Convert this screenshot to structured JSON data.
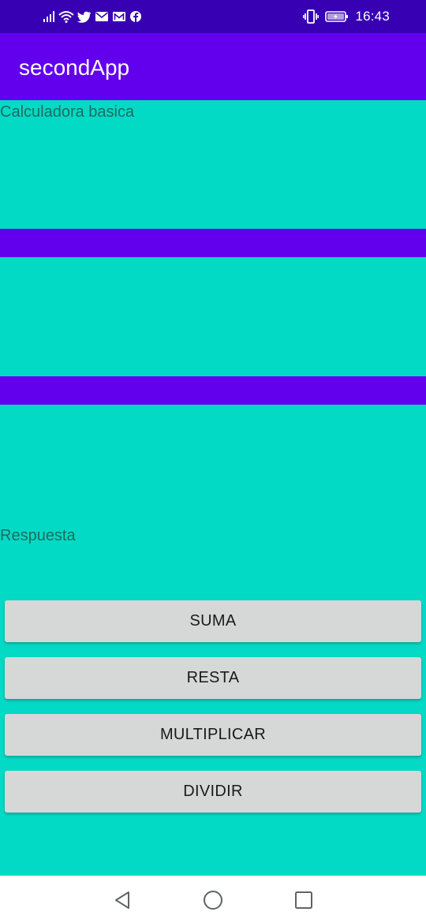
{
  "status_bar": {
    "time": "16:43",
    "left_icons": [
      "signal-icon",
      "wifi-icon",
      "twitter-icon",
      "mail-icon",
      "gmail-icon",
      "facebook-icon"
    ],
    "right_icons": [
      "vibrate-icon",
      "battery-charging-icon"
    ]
  },
  "app_bar": {
    "title": "secondApp",
    "color": "#6200ee"
  },
  "content": {
    "title_label": "Calculadora basica",
    "answer_label": "Respuesta",
    "background": "#03dac5",
    "input_color": "#6200ee"
  },
  "buttons": {
    "suma": "SUMA",
    "resta": "RESTA",
    "multiplicar": "MULTIPLICAR",
    "dividir": "DIVIDIR"
  },
  "nav_bar": {
    "icons": [
      "back-icon",
      "home-icon",
      "recents-icon"
    ]
  }
}
